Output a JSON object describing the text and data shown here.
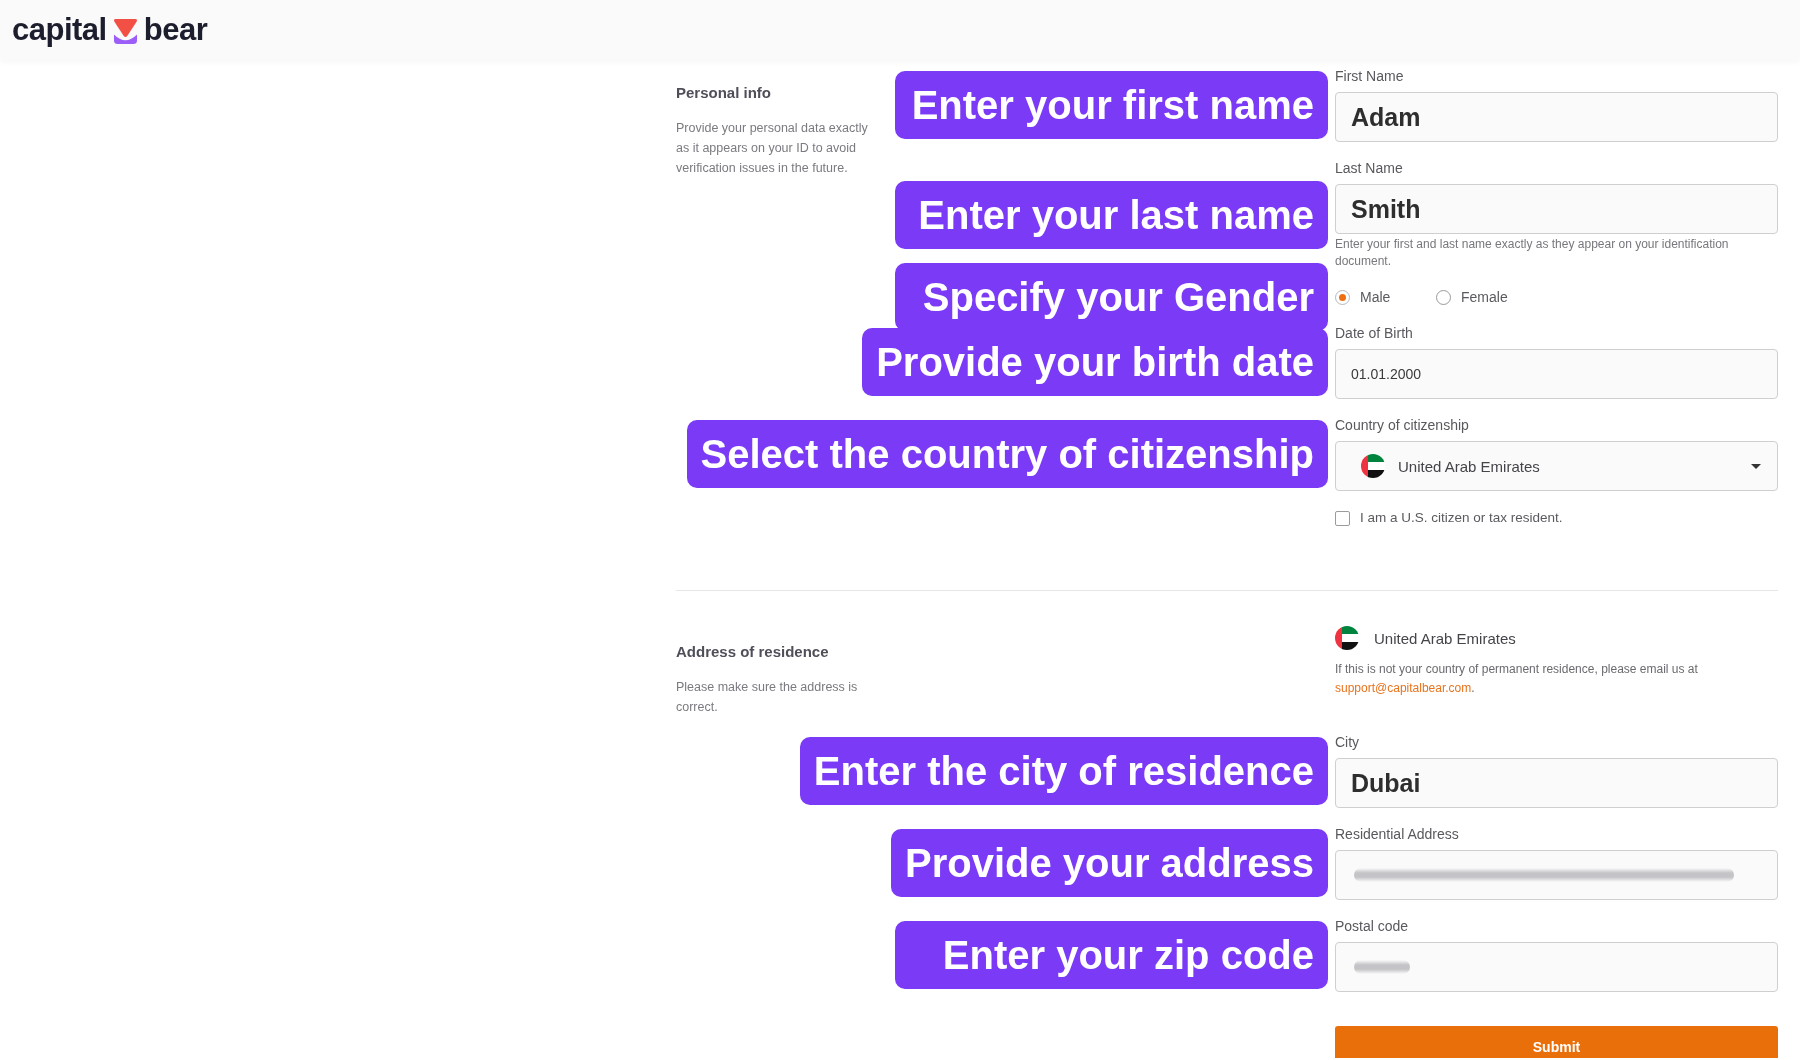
{
  "header": {
    "logo": {
      "left_word": "capital",
      "right_word": "bear"
    }
  },
  "sections": [
    {
      "title": "Personal info",
      "description": "Provide your personal data exactly as it appears on your ID to avoid verification issues in the future.",
      "rows": [
        {
          "kind": "text_input",
          "label": "First Name",
          "value": "Adam",
          "emphasized": true,
          "callout": "Enter your first name"
        },
        {
          "kind": "text_input",
          "label": "Last Name",
          "value": "Smith",
          "emphasized": true,
          "hint": "Enter your first and last name exactly as they appear on your identification document.",
          "callout": "Enter your last name"
        },
        {
          "kind": "radio_group",
          "options": [
            {
              "label": "Male",
              "selected": true
            },
            {
              "label": "Female",
              "selected": false
            }
          ],
          "callout": "Specify your Gender"
        },
        {
          "kind": "text_input",
          "label": "Date of Birth",
          "value": "01.01.2000",
          "emphasized": false,
          "callout": "Provide your birth date"
        },
        {
          "kind": "select",
          "label": "Country of citizenship",
          "value": "United Arab Emirates",
          "callout": "Select the country of citizenship"
        },
        {
          "kind": "checkbox",
          "label": "I am a U.S. citizen or tax resident.",
          "checked": false
        }
      ]
    },
    {
      "title": "Address of residence",
      "description": "Please make sure the address is correct.",
      "rows": [
        {
          "kind": "country_display",
          "value": "United Arab Emirates",
          "note": {
            "text": "If this is not your country of permanent residence, please email us at",
            "link": "support@capitalbear.com",
            "text_after": "."
          }
        },
        {
          "kind": "text_input",
          "label": "City",
          "value": "Dubai",
          "emphasized": true,
          "callout": "Enter the city of residence"
        },
        {
          "kind": "text_input",
          "label": "Residential Address",
          "redacted": true,
          "blur": {
            "kind": "long"
          },
          "callout": "Provide your address"
        },
        {
          "kind": "text_input",
          "label": "Postal code",
          "redacted": true,
          "blur": {
            "kind": "short"
          },
          "callout": "Enter your zip code"
        },
        {
          "kind": "button",
          "label": "Submit"
        }
      ]
    }
  ]
}
